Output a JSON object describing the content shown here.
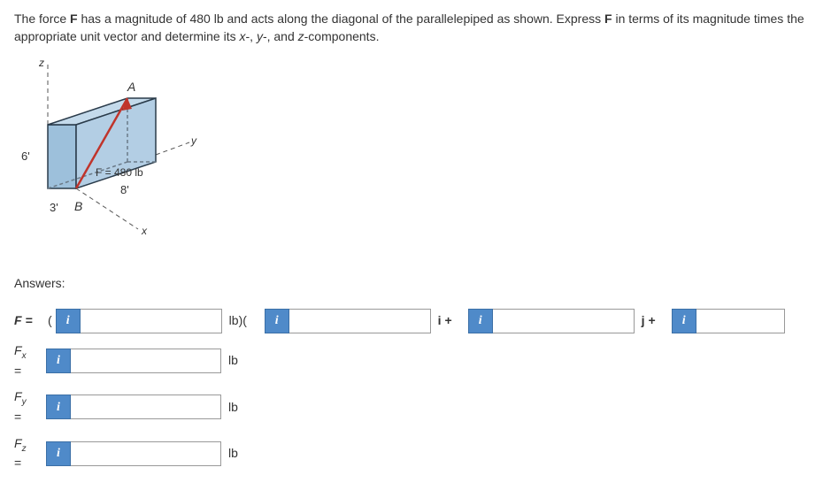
{
  "problem": {
    "pre": "The force ",
    "Fbold": "F",
    "mid1": " has a magnitude of 480 lb and acts along the diagonal of the parallelepiped as shown. Express ",
    "Fbold2": "F",
    "mid2": " in terms of its magnitude times the appropriate unit vector and determine its ",
    "x": "x",
    "dash1": "-, ",
    "y": "y",
    "dash2": "-, and ",
    "z": "z",
    "tail": "-components."
  },
  "diagram": {
    "dim_z": "6'",
    "dim_x": "3'",
    "dim_y": "8'",
    "pointA": "A",
    "pointB": "B",
    "forceLabel": "F = 480 lb",
    "axis_x": "x",
    "axis_y": "y",
    "axis_z": "z"
  },
  "answersLabel": "Answers:",
  "rows": {
    "F": {
      "label": "F =",
      "open": "(",
      "unit1": "lb)(",
      "iplus": "i +",
      "jplus": "j +"
    },
    "Fx": {
      "label": "F",
      "sub": "x",
      "eq": "=",
      "unit": "lb"
    },
    "Fy": {
      "label": "F",
      "sub": "y",
      "eq": "=",
      "unit": "lb"
    },
    "Fz": {
      "label": "F",
      "sub": "z",
      "eq": "=",
      "unit": "lb"
    }
  },
  "infoGlyph": "i"
}
